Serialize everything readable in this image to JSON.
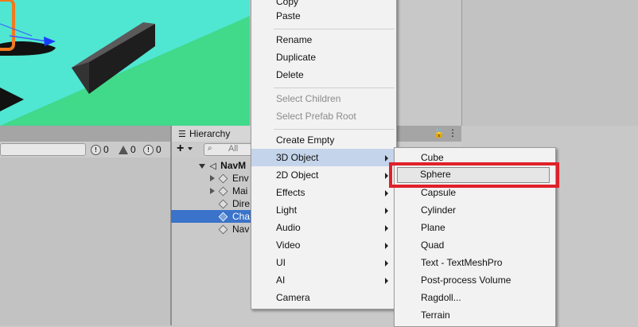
{
  "toolbar": {
    "warning_count": "0",
    "info_count": "0",
    "error_count": "0"
  },
  "hierarchy": {
    "tab_label": "Hierarchy",
    "add_label": "+",
    "search_placeholder": "All",
    "scene_name": "NavM",
    "items": [
      {
        "label": "Env",
        "expanded_arrow": true,
        "selected": false
      },
      {
        "label": "Mai",
        "expanded_arrow": true,
        "selected": false
      },
      {
        "label": "Dire",
        "expanded_arrow": false,
        "selected": false
      },
      {
        "label": "Cha",
        "expanded_arrow": false,
        "selected": true
      },
      {
        "label": "Nav",
        "expanded_arrow": false,
        "selected": false
      }
    ]
  },
  "context_menu": {
    "items": [
      {
        "label": "Copy"
      },
      {
        "label": "Paste"
      },
      {
        "label": "Rename"
      },
      {
        "label": "Duplicate"
      },
      {
        "label": "Delete"
      },
      {
        "label": "Select Children"
      },
      {
        "label": "Select Prefab Root"
      },
      {
        "label": "Create Empty"
      },
      {
        "label": "3D Object"
      },
      {
        "label": "2D Object"
      },
      {
        "label": "Effects"
      },
      {
        "label": "Light"
      },
      {
        "label": "Audio"
      },
      {
        "label": "Video"
      },
      {
        "label": "UI"
      },
      {
        "label": "AI"
      },
      {
        "label": "Camera"
      }
    ]
  },
  "submenu_3d": {
    "items": [
      {
        "label": "Cube"
      },
      {
        "label": "Sphere"
      },
      {
        "label": "Capsule"
      },
      {
        "label": "Cylinder"
      },
      {
        "label": "Plane"
      },
      {
        "label": "Quad"
      },
      {
        "label": "Text - TextMeshPro"
      },
      {
        "label": "Post-process Volume"
      },
      {
        "label": "Ragdoll..."
      },
      {
        "label": "Terrain"
      }
    ]
  },
  "colors": {
    "scene_sky": "#4fe6d2",
    "scene_ground": "#41d98a",
    "highlight_box": "#e0202a",
    "selection": "#3a73c9",
    "menu_hover": "#c4d4ea"
  }
}
